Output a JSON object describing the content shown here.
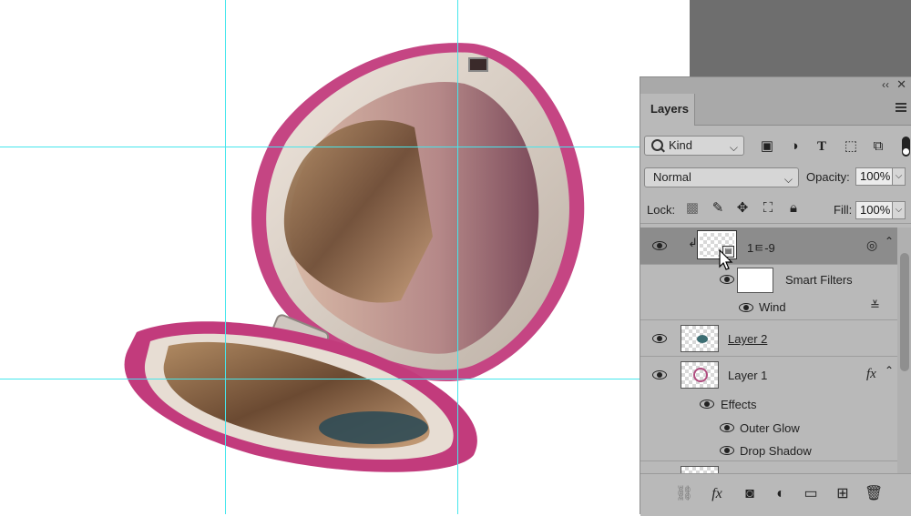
{
  "layers_panel": {
    "tab_label": "Layers",
    "collapse_glyph": "‹‹",
    "close_glyph": "✕",
    "filter": {
      "kind_label": "Kind",
      "icons": [
        "image-filter-icon",
        "adjustment-filter-icon",
        "type-filter-icon",
        "shape-filter-icon",
        "smart-object-filter-icon"
      ]
    },
    "blend_mode": "Normal",
    "opacity_label": "Opacity:",
    "opacity_value": "100%",
    "lock_label": "Lock:",
    "fill_label": "Fill:",
    "fill_value": "100%",
    "layers": [
      {
        "name": "1ㅌ-9",
        "selected": true,
        "type": "smart-object"
      },
      {
        "sub_label": "Smart Filters"
      },
      {
        "sub_label": "Wind"
      },
      {
        "name": "Layer 2"
      },
      {
        "name": "Layer 1",
        "fx": "fx"
      },
      {
        "sub_label": "Effects"
      },
      {
        "sub_label": "Outer Glow"
      },
      {
        "sub_label": "Drop Shadow"
      }
    ],
    "bottom_icons": [
      "link-icon",
      "fx-icon",
      "mask-icon",
      "adjustment-icon",
      "folder-icon",
      "new-layer-icon",
      "trash-icon"
    ],
    "bottom_fx_label": "fx"
  },
  "colors": {
    "guide": "#46e6ec",
    "compact_case": "#c23b7c",
    "pasteboard": "#6e6e6e",
    "panel_bg": "#b9b9b9"
  }
}
